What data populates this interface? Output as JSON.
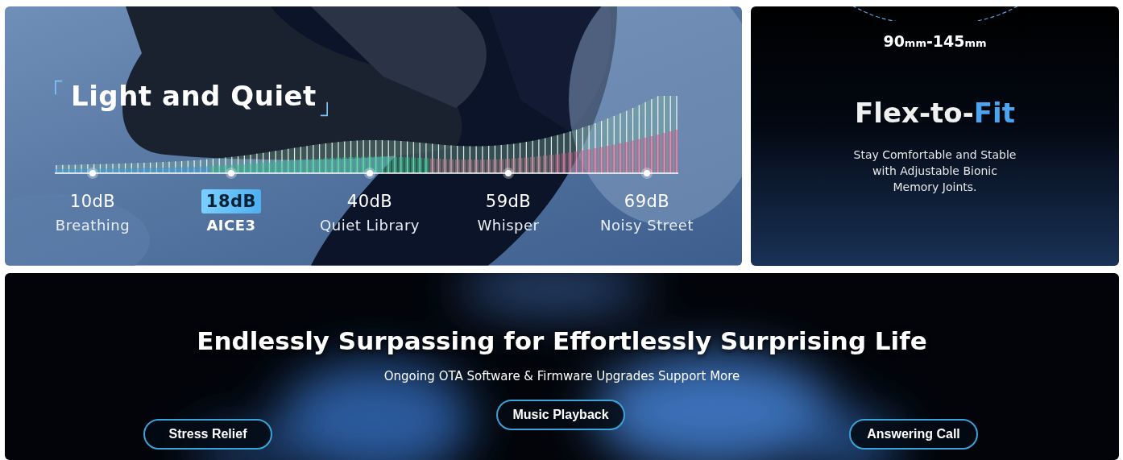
{
  "quiet_card": {
    "title": "Light and Quiet",
    "levels": [
      {
        "value": "10dB",
        "label": "Breathing",
        "selected": false
      },
      {
        "value": "18dB",
        "label": "AICE3",
        "selected": true
      },
      {
        "value": "40dB",
        "label": "Quiet Library",
        "selected": false
      },
      {
        "value": "59dB",
        "label": "Whisper",
        "selected": false
      },
      {
        "value": "69dB",
        "label": "Noisy Street",
        "selected": false
      }
    ]
  },
  "fit_card": {
    "size_range": [
      {
        "text": "90",
        "small": false
      },
      {
        "text": "mm",
        "small": true
      },
      {
        "text": "-145",
        "small": false
      },
      {
        "text": "mm",
        "small": true
      }
    ],
    "title": "Flex-to-",
    "title_accent": "Fit",
    "description": "Stay Comfortable and Stable with Adjustable Bionic Memory Joints."
  },
  "ota_banner": {
    "heading": "Endlessly Surpassing for Effortlessly Surprising Life",
    "subheading": "Ongoing OTA Software & Firmware Upgrades Support More",
    "features": [
      "Stress Relief",
      "Music Playback",
      "Answering Call"
    ]
  }
}
